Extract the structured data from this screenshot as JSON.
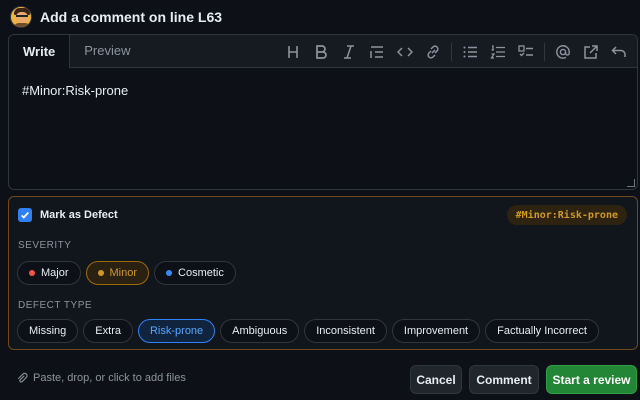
{
  "header": {
    "title": "Add a comment on line L63"
  },
  "editor": {
    "tabs": [
      {
        "label": "Write",
        "active": true
      },
      {
        "label": "Preview",
        "active": false
      }
    ],
    "toolbar": [
      {
        "name": "heading",
        "glyph": "H"
      },
      {
        "name": "bold",
        "glyph": "B"
      },
      {
        "name": "italic",
        "glyph": "I"
      },
      {
        "name": "quote",
        "glyph": ""
      },
      {
        "name": "code",
        "glyph": "<>"
      },
      {
        "name": "link",
        "glyph": ""
      },
      {
        "name": "bulleted-list",
        "glyph": ""
      },
      {
        "name": "numbered-list",
        "glyph": ""
      },
      {
        "name": "task-list",
        "glyph": ""
      },
      {
        "name": "mention",
        "glyph": "@"
      },
      {
        "name": "reference",
        "glyph": ""
      },
      {
        "name": "undo",
        "glyph": ""
      }
    ],
    "text": "#Minor:Risk-prone"
  },
  "defect": {
    "mark_label": "Mark as Defect",
    "checked": true,
    "tag": "#Minor:Risk-prone",
    "severity_label": "SEVERITY",
    "severities": [
      {
        "label": "Major",
        "color": "#f85149",
        "selected": false
      },
      {
        "label": "Minor",
        "color": "#d29922",
        "selected": true
      },
      {
        "label": "Cosmetic",
        "color": "#388bfd",
        "selected": false
      }
    ],
    "type_label": "DEFECT TYPE",
    "types": [
      {
        "label": "Missing",
        "selected": false
      },
      {
        "label": "Extra",
        "selected": false
      },
      {
        "label": "Risk-prone",
        "selected": true
      },
      {
        "label": "Ambiguous",
        "selected": false
      },
      {
        "label": "Inconsistent",
        "selected": false
      },
      {
        "label": "Improvement",
        "selected": false
      },
      {
        "label": "Factually Incorrect",
        "selected": false
      }
    ]
  },
  "footer": {
    "hint": "Paste, drop, or click to add files",
    "cancel_label": "Cancel",
    "comment_label": "Comment",
    "review_label": "Start a review"
  },
  "colors": {
    "accent_blue": "#2f81f7",
    "primary_green": "#238636",
    "warning_amber": "#d29922"
  }
}
